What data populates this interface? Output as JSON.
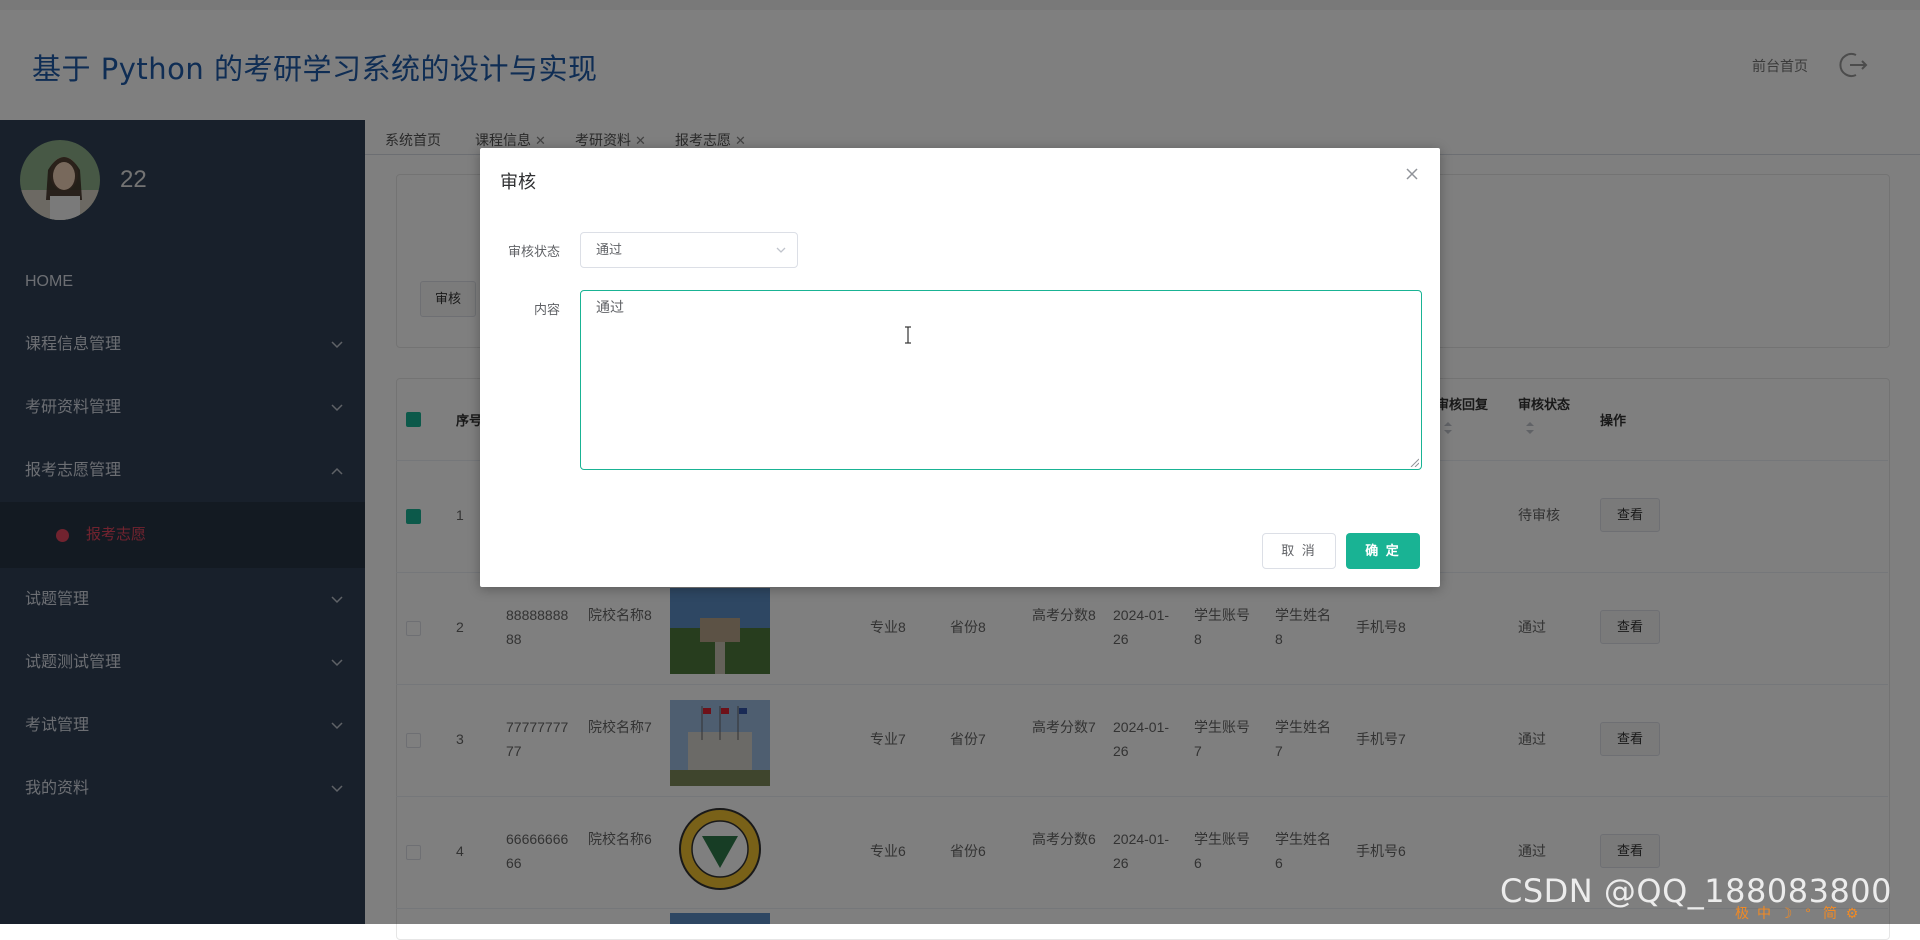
{
  "header": {
    "title": "基于 Python 的考研学习系统的设计与实现",
    "front_link": "前台首页"
  },
  "user": {
    "name": "22"
  },
  "menu": {
    "home": "HOME",
    "items": [
      "课程信息管理",
      "考研资料管理",
      "报考志愿管理"
    ],
    "active_sub": "报考志愿",
    "items_after": [
      "试题管理",
      "试题测试管理",
      "考试管理",
      "我的资料"
    ]
  },
  "tabs": [
    {
      "label": "系统首页"
    },
    {
      "label": "课程信息"
    },
    {
      "label": "考研资料"
    },
    {
      "label": "报考志愿"
    }
  ],
  "toolbar": {
    "review_label": "审核"
  },
  "table": {
    "headers": {
      "index": "序号",
      "review_reply": "审核回复",
      "review_status": "审核状态",
      "actions": "操作"
    },
    "rows": [
      {
        "index": "1",
        "status": "待审核",
        "view": "查看"
      },
      {
        "index": "2",
        "id": "8888888888",
        "school": "院校名称8",
        "major": "专业8",
        "province": "省份8",
        "score": "高考分数8",
        "date": "2024-01-26",
        "account": "学生账号8",
        "student": "学生姓名8",
        "phone": "手机号8",
        "status": "通过",
        "view": "查看"
      },
      {
        "index": "3",
        "id": "7777777777",
        "school": "院校名称7",
        "major": "专业7",
        "province": "省份7",
        "score": "高考分数7",
        "date": "2024-01-26",
        "account": "学生账号7",
        "student": "学生姓名7",
        "phone": "手机号7",
        "status": "通过",
        "view": "查看"
      },
      {
        "index": "4",
        "id": "6666666666",
        "school": "院校名称6",
        "major": "专业6",
        "province": "省份6",
        "score": "高考分数6",
        "date": "2024-01-26",
        "account": "学生账号6",
        "student": "学生姓名6",
        "phone": "手机号6",
        "status": "通过",
        "view": "查看"
      }
    ]
  },
  "dialog": {
    "title": "审核",
    "status_label": "审核状态",
    "status_value": "通过",
    "content_label": "内容",
    "content_value": "通过",
    "cancel_label": "取 消",
    "ok_label": "确 定"
  },
  "watermark": "CSDN @QQ_188083800",
  "ime": [
    "极",
    "中",
    "☽",
    "°",
    "简",
    "⚙"
  ],
  "colors": {
    "accent": "#19b394",
    "sidebar": "#304156",
    "title": "#1e5aa8",
    "active_menu": "#e2475e"
  }
}
